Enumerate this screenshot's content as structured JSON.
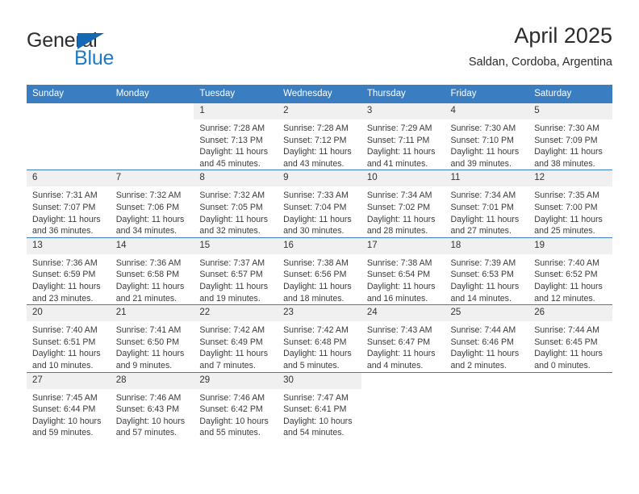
{
  "brand": {
    "name_top": "General",
    "name_bottom": "Blue",
    "triangle_color": "#1568b4",
    "blue_color": "#1f7ac4"
  },
  "header": {
    "title": "April 2025",
    "subtitle": "Saldan, Cordoba, Argentina"
  },
  "theme": {
    "header_blue": "#3a7dc0",
    "daynum_band": "#f0f0f0"
  },
  "weekday_headers": [
    "Sunday",
    "Monday",
    "Tuesday",
    "Wednesday",
    "Thursday",
    "Friday",
    "Saturday"
  ],
  "weeks": [
    [
      {
        "day": "",
        "sunrise": "",
        "sunset": "",
        "daylight_line1": "",
        "daylight_line2": "",
        "empty": true
      },
      {
        "day": "",
        "sunrise": "",
        "sunset": "",
        "daylight_line1": "",
        "daylight_line2": "",
        "empty": true
      },
      {
        "day": "1",
        "sunrise": "Sunrise: 7:28 AM",
        "sunset": "Sunset: 7:13 PM",
        "daylight_line1": "Daylight: 11 hours",
        "daylight_line2": "and 45 minutes.",
        "empty": false
      },
      {
        "day": "2",
        "sunrise": "Sunrise: 7:28 AM",
        "sunset": "Sunset: 7:12 PM",
        "daylight_line1": "Daylight: 11 hours",
        "daylight_line2": "and 43 minutes.",
        "empty": false
      },
      {
        "day": "3",
        "sunrise": "Sunrise: 7:29 AM",
        "sunset": "Sunset: 7:11 PM",
        "daylight_line1": "Daylight: 11 hours",
        "daylight_line2": "and 41 minutes.",
        "empty": false
      },
      {
        "day": "4",
        "sunrise": "Sunrise: 7:30 AM",
        "sunset": "Sunset: 7:10 PM",
        "daylight_line1": "Daylight: 11 hours",
        "daylight_line2": "and 39 minutes.",
        "empty": false
      },
      {
        "day": "5",
        "sunrise": "Sunrise: 7:30 AM",
        "sunset": "Sunset: 7:09 PM",
        "daylight_line1": "Daylight: 11 hours",
        "daylight_line2": "and 38 minutes.",
        "empty": false
      }
    ],
    [
      {
        "day": "6",
        "sunrise": "Sunrise: 7:31 AM",
        "sunset": "Sunset: 7:07 PM",
        "daylight_line1": "Daylight: 11 hours",
        "daylight_line2": "and 36 minutes.",
        "empty": false
      },
      {
        "day": "7",
        "sunrise": "Sunrise: 7:32 AM",
        "sunset": "Sunset: 7:06 PM",
        "daylight_line1": "Daylight: 11 hours",
        "daylight_line2": "and 34 minutes.",
        "empty": false
      },
      {
        "day": "8",
        "sunrise": "Sunrise: 7:32 AM",
        "sunset": "Sunset: 7:05 PM",
        "daylight_line1": "Daylight: 11 hours",
        "daylight_line2": "and 32 minutes.",
        "empty": false
      },
      {
        "day": "9",
        "sunrise": "Sunrise: 7:33 AM",
        "sunset": "Sunset: 7:04 PM",
        "daylight_line1": "Daylight: 11 hours",
        "daylight_line2": "and 30 minutes.",
        "empty": false
      },
      {
        "day": "10",
        "sunrise": "Sunrise: 7:34 AM",
        "sunset": "Sunset: 7:02 PM",
        "daylight_line1": "Daylight: 11 hours",
        "daylight_line2": "and 28 minutes.",
        "empty": false
      },
      {
        "day": "11",
        "sunrise": "Sunrise: 7:34 AM",
        "sunset": "Sunset: 7:01 PM",
        "daylight_line1": "Daylight: 11 hours",
        "daylight_line2": "and 27 minutes.",
        "empty": false
      },
      {
        "day": "12",
        "sunrise": "Sunrise: 7:35 AM",
        "sunset": "Sunset: 7:00 PM",
        "daylight_line1": "Daylight: 11 hours",
        "daylight_line2": "and 25 minutes.",
        "empty": false
      }
    ],
    [
      {
        "day": "13",
        "sunrise": "Sunrise: 7:36 AM",
        "sunset": "Sunset: 6:59 PM",
        "daylight_line1": "Daylight: 11 hours",
        "daylight_line2": "and 23 minutes.",
        "empty": false
      },
      {
        "day": "14",
        "sunrise": "Sunrise: 7:36 AM",
        "sunset": "Sunset: 6:58 PM",
        "daylight_line1": "Daylight: 11 hours",
        "daylight_line2": "and 21 minutes.",
        "empty": false
      },
      {
        "day": "15",
        "sunrise": "Sunrise: 7:37 AM",
        "sunset": "Sunset: 6:57 PM",
        "daylight_line1": "Daylight: 11 hours",
        "daylight_line2": "and 19 minutes.",
        "empty": false
      },
      {
        "day": "16",
        "sunrise": "Sunrise: 7:38 AM",
        "sunset": "Sunset: 6:56 PM",
        "daylight_line1": "Daylight: 11 hours",
        "daylight_line2": "and 18 minutes.",
        "empty": false
      },
      {
        "day": "17",
        "sunrise": "Sunrise: 7:38 AM",
        "sunset": "Sunset: 6:54 PM",
        "daylight_line1": "Daylight: 11 hours",
        "daylight_line2": "and 16 minutes.",
        "empty": false
      },
      {
        "day": "18",
        "sunrise": "Sunrise: 7:39 AM",
        "sunset": "Sunset: 6:53 PM",
        "daylight_line1": "Daylight: 11 hours",
        "daylight_line2": "and 14 minutes.",
        "empty": false
      },
      {
        "day": "19",
        "sunrise": "Sunrise: 7:40 AM",
        "sunset": "Sunset: 6:52 PM",
        "daylight_line1": "Daylight: 11 hours",
        "daylight_line2": "and 12 minutes.",
        "empty": false
      }
    ],
    [
      {
        "day": "20",
        "sunrise": "Sunrise: 7:40 AM",
        "sunset": "Sunset: 6:51 PM",
        "daylight_line1": "Daylight: 11 hours",
        "daylight_line2": "and 10 minutes.",
        "empty": false
      },
      {
        "day": "21",
        "sunrise": "Sunrise: 7:41 AM",
        "sunset": "Sunset: 6:50 PM",
        "daylight_line1": "Daylight: 11 hours",
        "daylight_line2": "and 9 minutes.",
        "empty": false
      },
      {
        "day": "22",
        "sunrise": "Sunrise: 7:42 AM",
        "sunset": "Sunset: 6:49 PM",
        "daylight_line1": "Daylight: 11 hours",
        "daylight_line2": "and 7 minutes.",
        "empty": false
      },
      {
        "day": "23",
        "sunrise": "Sunrise: 7:42 AM",
        "sunset": "Sunset: 6:48 PM",
        "daylight_line1": "Daylight: 11 hours",
        "daylight_line2": "and 5 minutes.",
        "empty": false
      },
      {
        "day": "24",
        "sunrise": "Sunrise: 7:43 AM",
        "sunset": "Sunset: 6:47 PM",
        "daylight_line1": "Daylight: 11 hours",
        "daylight_line2": "and 4 minutes.",
        "empty": false
      },
      {
        "day": "25",
        "sunrise": "Sunrise: 7:44 AM",
        "sunset": "Sunset: 6:46 PM",
        "daylight_line1": "Daylight: 11 hours",
        "daylight_line2": "and 2 minutes.",
        "empty": false
      },
      {
        "day": "26",
        "sunrise": "Sunrise: 7:44 AM",
        "sunset": "Sunset: 6:45 PM",
        "daylight_line1": "Daylight: 11 hours",
        "daylight_line2": "and 0 minutes.",
        "empty": false
      }
    ],
    [
      {
        "day": "27",
        "sunrise": "Sunrise: 7:45 AM",
        "sunset": "Sunset: 6:44 PM",
        "daylight_line1": "Daylight: 10 hours",
        "daylight_line2": "and 59 minutes.",
        "empty": false
      },
      {
        "day": "28",
        "sunrise": "Sunrise: 7:46 AM",
        "sunset": "Sunset: 6:43 PM",
        "daylight_line1": "Daylight: 10 hours",
        "daylight_line2": "and 57 minutes.",
        "empty": false
      },
      {
        "day": "29",
        "sunrise": "Sunrise: 7:46 AM",
        "sunset": "Sunset: 6:42 PM",
        "daylight_line1": "Daylight: 10 hours",
        "daylight_line2": "and 55 minutes.",
        "empty": false
      },
      {
        "day": "30",
        "sunrise": "Sunrise: 7:47 AM",
        "sunset": "Sunset: 6:41 PM",
        "daylight_line1": "Daylight: 10 hours",
        "daylight_line2": "and 54 minutes.",
        "empty": false
      },
      {
        "day": "",
        "sunrise": "",
        "sunset": "",
        "daylight_line1": "",
        "daylight_line2": "",
        "empty": true
      },
      {
        "day": "",
        "sunrise": "",
        "sunset": "",
        "daylight_line1": "",
        "daylight_line2": "",
        "empty": true
      },
      {
        "day": "",
        "sunrise": "",
        "sunset": "",
        "daylight_line1": "",
        "daylight_line2": "",
        "empty": true
      }
    ]
  ]
}
